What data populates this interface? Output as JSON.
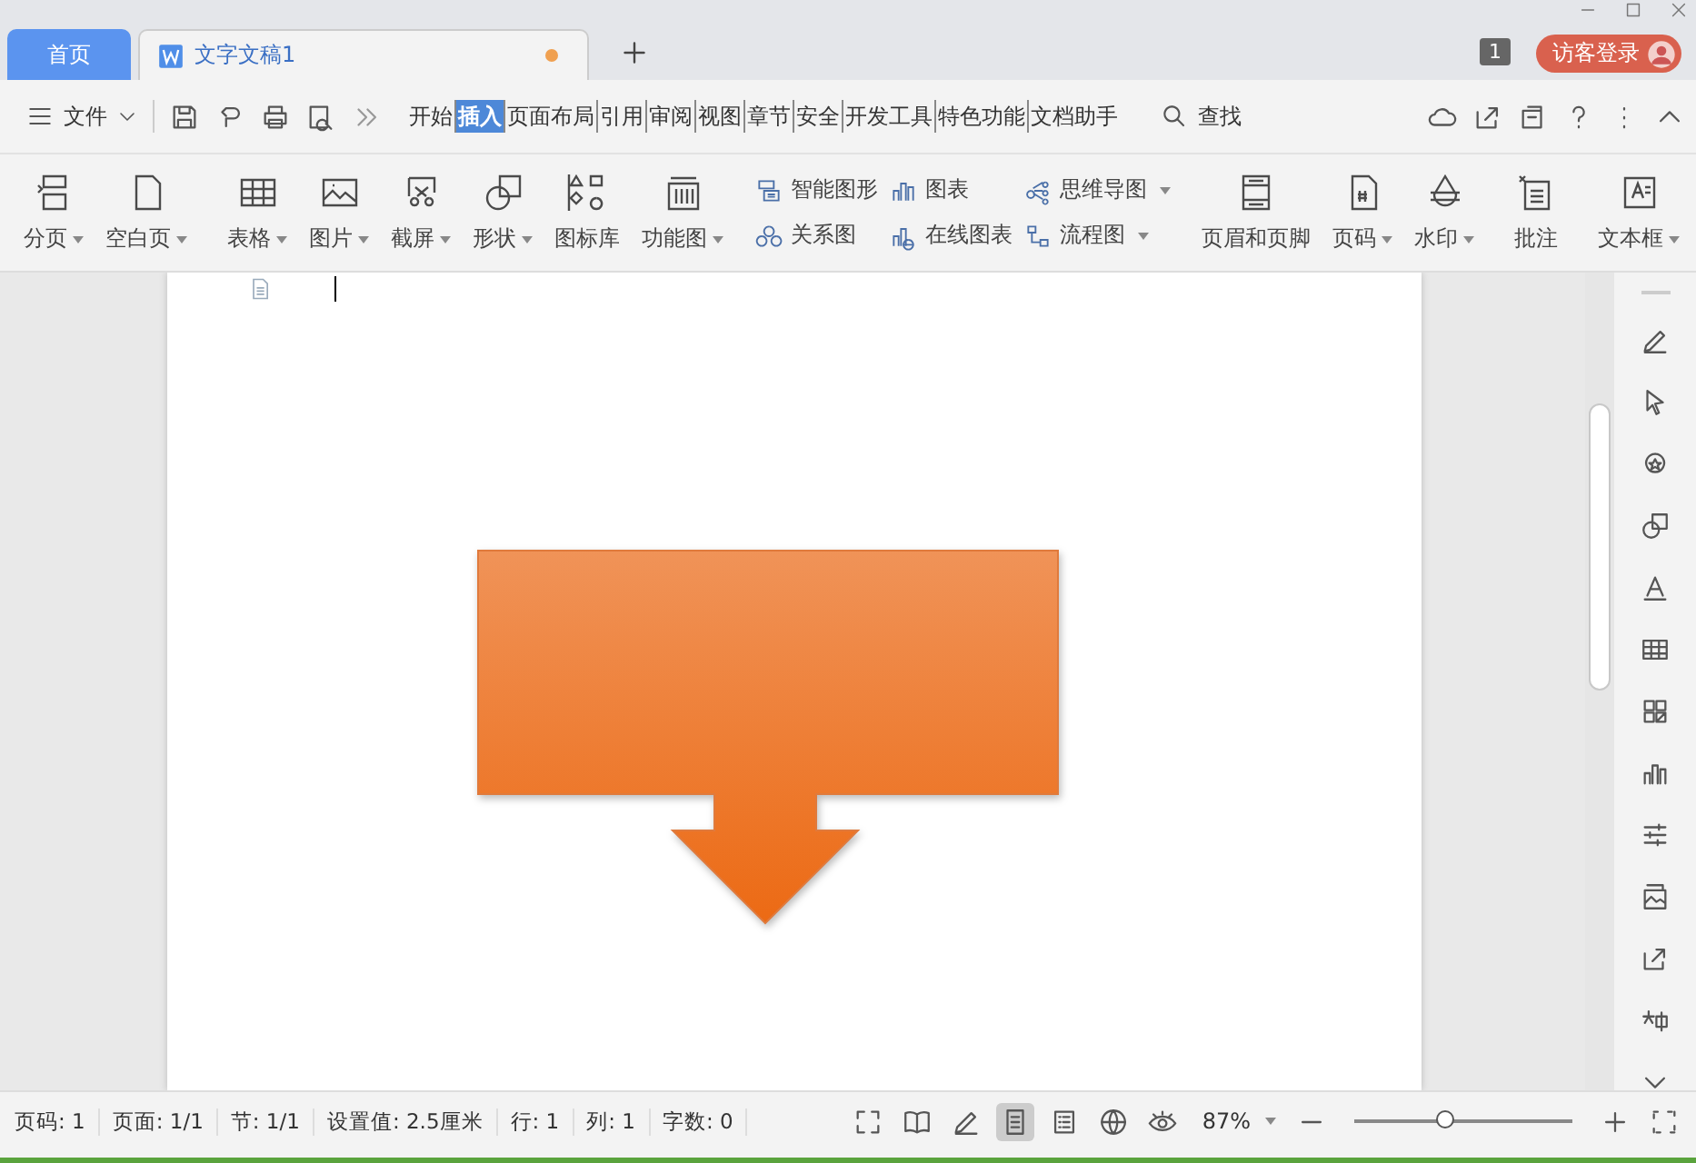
{
  "tabs": [
    {
      "label": "首页",
      "kind": "home",
      "selected": false
    },
    {
      "label": "文字文稿1",
      "kind": "doc",
      "selected": true,
      "modified": true
    }
  ],
  "title_bar": {
    "badge": "1",
    "login": "访客登录"
  },
  "menu_bar": {
    "file": "文件",
    "tabs": [
      {
        "label": "开始",
        "selected": false
      },
      {
        "label": "插入",
        "selected": true
      },
      {
        "label": "页面布局",
        "selected": false
      },
      {
        "label": "引用",
        "selected": false
      },
      {
        "label": "审阅",
        "selected": false
      },
      {
        "label": "视图",
        "selected": false
      },
      {
        "label": "章节",
        "selected": false
      },
      {
        "label": "安全",
        "selected": false
      },
      {
        "label": "开发工具",
        "selected": false
      },
      {
        "label": "特色功能",
        "selected": false
      },
      {
        "label": "文档助手",
        "selected": false
      }
    ],
    "search": "查找"
  },
  "ribbon": {
    "groups": [
      {
        "kind": "big",
        "items": [
          {
            "label": "分页",
            "dropdown": true
          },
          {
            "label": "空白页",
            "dropdown": true
          }
        ]
      },
      {
        "kind": "big",
        "items": [
          {
            "label": "表格",
            "dropdown": true
          },
          {
            "label": "图片",
            "dropdown": true
          },
          {
            "label": "截屏",
            "dropdown": true
          },
          {
            "label": "形状",
            "dropdown": true
          },
          {
            "label": "图标库",
            "dropdown": false
          },
          {
            "label": "功能图",
            "dropdown": true
          }
        ]
      },
      {
        "kind": "small",
        "items": [
          {
            "label": "智能图形",
            "dropdown": false
          },
          {
            "label": "关系图",
            "dropdown": false
          },
          {
            "label": "图表",
            "dropdown": false
          },
          {
            "label": "在线图表",
            "dropdown": false
          },
          {
            "label": "思维导图",
            "dropdown": true
          },
          {
            "label": "流程图",
            "dropdown": true
          }
        ]
      },
      {
        "kind": "big",
        "items": [
          {
            "label": "页眉和页脚",
            "dropdown": false
          },
          {
            "label": "页码",
            "dropdown": true
          },
          {
            "label": "水印",
            "dropdown": true
          }
        ]
      },
      {
        "kind": "big",
        "items": [
          {
            "label": "批注",
            "dropdown": false
          }
        ]
      },
      {
        "kind": "big",
        "items": [
          {
            "label": "文本框",
            "dropdown": true
          }
        ]
      }
    ]
  },
  "status_bar": {
    "items": [
      "页码: 1",
      "页面: 1/1",
      "节: 1/1",
      "设置值: 2.5厘米",
      "行: 1",
      "列: 1",
      "字数: 0"
    ],
    "views": [
      {
        "selected": false
      },
      {
        "selected": false
      },
      {
        "selected": false
      },
      {
        "selected": true
      },
      {
        "selected": false
      },
      {
        "selected": false
      },
      {
        "selected": false
      }
    ],
    "zoom": "87%",
    "zoom_slider": {
      "level": 0.42
    }
  }
}
